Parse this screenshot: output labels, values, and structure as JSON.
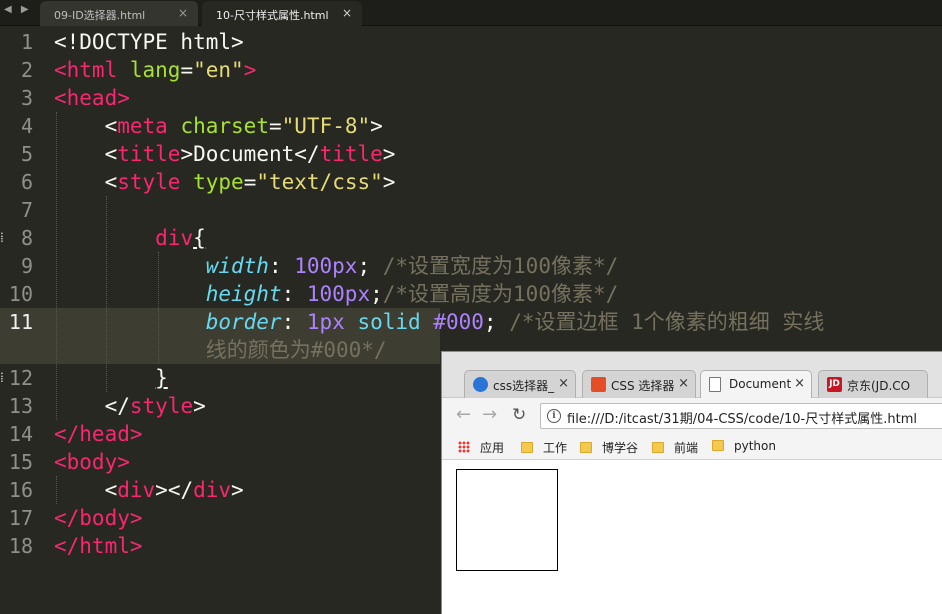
{
  "editor": {
    "nav_arrows": "◀ ▶",
    "tabs": [
      {
        "label": "09-ID选择器.html",
        "close": "×"
      },
      {
        "label": "10-尺寸样式属性.html",
        "close": "×"
      }
    ],
    "line_numbers": [
      "1",
      "2",
      "3",
      "4",
      "5",
      "6",
      "7",
      "8",
      "9",
      "10",
      "11",
      "12",
      "13",
      "14",
      "15",
      "16",
      "17",
      "18"
    ],
    "code": {
      "doctype": "<!DOCTYPE html>",
      "html_open": "<html",
      "lang_attr": "lang",
      "lang_val": "\"en\"",
      "head_open": "<head>",
      "meta_open": "<meta",
      "charset_attr": "charset",
      "charset_val": "\"UTF-8\"",
      "title_open": "<title>",
      "title_text": "Document",
      "title_close": "</title>",
      "style_open": "<style",
      "type_attr": "type",
      "type_val": "\"text/css\"",
      "selector": "div",
      "brace_open": "{",
      "width_prop": "width",
      "width_val": "100px",
      "width_comment": "/*设置宽度为100像素*/",
      "height_prop": "height",
      "height_val": "100px",
      "height_comment": "/*设置高度为100像素*/",
      "border_prop": "border",
      "border_num": "1px",
      "border_kw": "solid",
      "border_color": "#000",
      "border_comment_1": "/*设置边框 1个像素的粗细 实线",
      "border_comment_2": "线的颜色为#000*/",
      "brace_close": "}",
      "style_close": "</style>",
      "head_close": "</head>",
      "body_open": "<body>",
      "div_tags": "<div></div>",
      "body_close": "</body>",
      "html_close": "</html>"
    }
  },
  "browser": {
    "tabs": [
      {
        "label": "css选择器_",
        "close": "×"
      },
      {
        "label": "CSS 选择器",
        "close": "×"
      },
      {
        "label": "Document",
        "close": "×"
      },
      {
        "label": "京东(JD.CO",
        "favicon_text": "JD"
      }
    ],
    "nav": {
      "back": "←",
      "forward": "→",
      "reload": "↻"
    },
    "address": "file:///D:/itcast/31期/04-CSS/code/10-尺寸样式属性.html",
    "info_glyph": "i",
    "bookmarks": [
      "应用",
      "工作",
      "博学谷",
      "前端",
      "python"
    ]
  },
  "colors": {
    "editor_bg": "#272822",
    "tag": "#f92672",
    "attribute": "#a6e22e",
    "string": "#e6db74",
    "property": "#66d9ef",
    "number": "#ae81ff",
    "comment": "#75715e"
  }
}
